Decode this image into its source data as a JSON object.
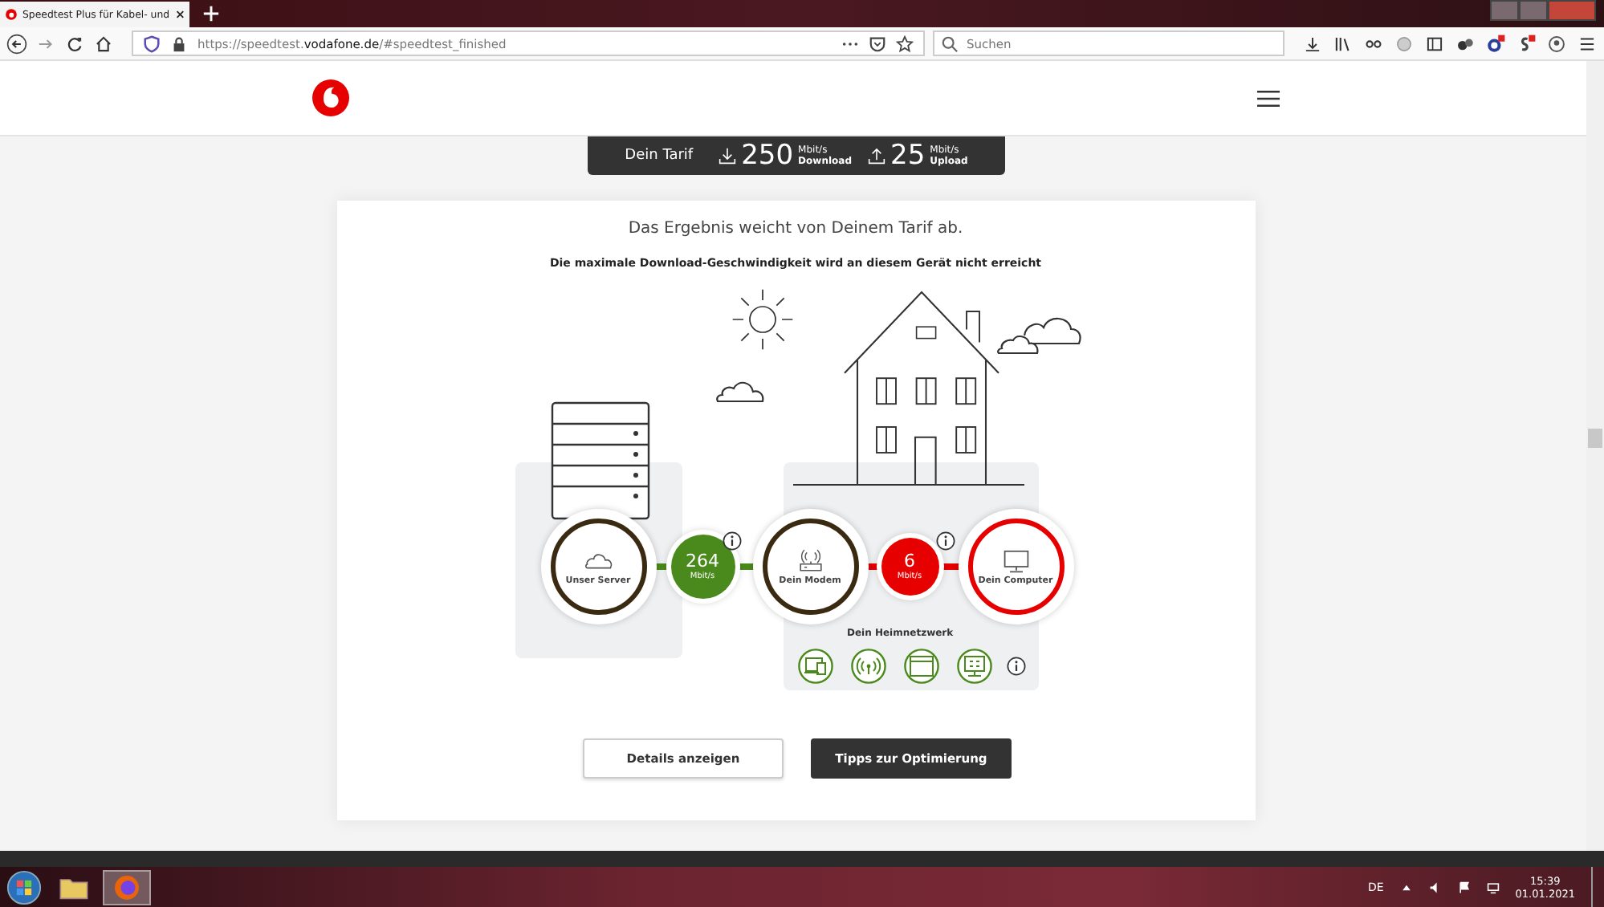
{
  "browser": {
    "tab_title": "Speedtest Plus für Kabel- und",
    "url_prefix": "https://speedtest.",
    "url_domain": "vodafone.de",
    "url_rest": "/#speedtest_finished",
    "search_placeholder": "Suchen"
  },
  "tariff": {
    "label": "Dein Tarif",
    "download": {
      "value": "250",
      "unit": "Mbit/s",
      "caption": "Download"
    },
    "upload": {
      "value": "25",
      "unit": "Mbit/s",
      "caption": "Upload"
    }
  },
  "result": {
    "headline": "Das Ergebnis weicht von Deinem Tarif ab.",
    "subline": "Die maximale Download-Geschwindigkeit wird an diesem Gerät nicht erreicht"
  },
  "nodes": [
    {
      "kind": "endpoint",
      "label": "Unser Server",
      "color": "#3b2a12"
    },
    {
      "kind": "speed",
      "value": "264",
      "unit": "Mbit/s",
      "color": "#4a8a1c"
    },
    {
      "kind": "endpoint",
      "label": "Dein Modem",
      "color": "#3b2a12"
    },
    {
      "kind": "speed",
      "value": "6",
      "unit": "Mbit/s",
      "color": "#e60000"
    },
    {
      "kind": "endpoint",
      "label": "Dein Computer",
      "color": "#e60000"
    }
  ],
  "home_network": {
    "label": "Dein Heimnetzwerk"
  },
  "buttons": [
    {
      "label": "Details anzeigen",
      "kind": "secondary"
    },
    {
      "label": "Tipps zur Optimierung",
      "kind": "primary"
    }
  ],
  "taskbar": {
    "language": "DE",
    "time": "15:39",
    "date": "01.01.2021"
  }
}
